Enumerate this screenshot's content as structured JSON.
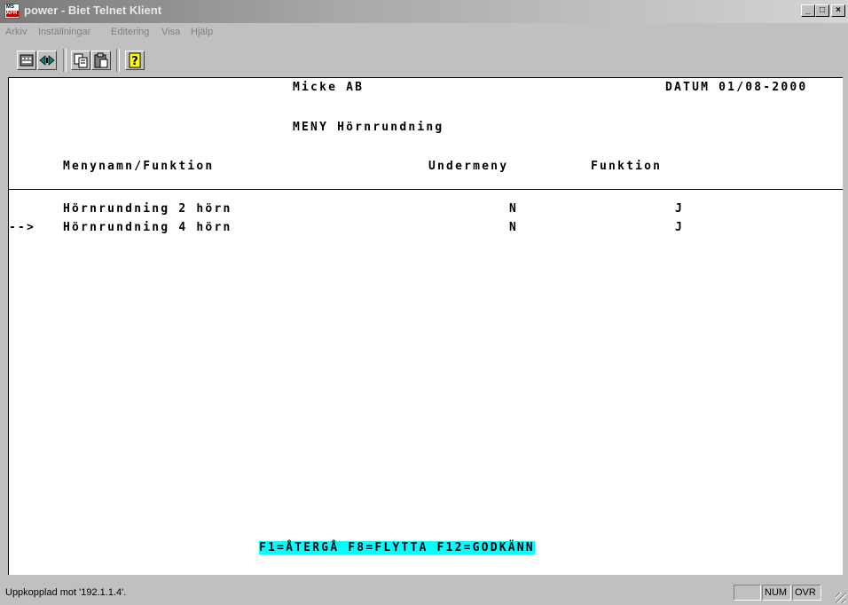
{
  "window": {
    "title": "power - Biet Telnet Klient",
    "icon_label_top": "MS",
    "icon_label_bottom": "AFR",
    "controls": {
      "minimize": "_",
      "maximize": "□",
      "close": "×"
    }
  },
  "menu": [
    {
      "label": "Arkiv",
      "name": "menu-arkiv"
    },
    {
      "label": "Inställningar",
      "name": "menu-installningar"
    },
    {
      "label": "Editering",
      "name": "menu-editering"
    },
    {
      "label": "Visa",
      "name": "menu-visa"
    },
    {
      "label": "Hjälp",
      "name": "menu-hjalp"
    }
  ],
  "toolbar": {
    "buttons": [
      "keyboard-icon",
      "connect-icon",
      "copy-icon",
      "paste-icon",
      "help-icon"
    ],
    "help_glyph": "?"
  },
  "terminal": {
    "company": "Micke AB",
    "date_label": "DATUM 01/08-2000",
    "menu_title": "MENY Hörnrundning",
    "columns": {
      "name": "Menynamn/Funktion",
      "submenu": "Undermeny",
      "function": "Funktion"
    },
    "rows": [
      {
        "pointer": "",
        "name": "Hörnrundning 2 hörn",
        "submenu": "N",
        "function": "J"
      },
      {
        "pointer": "-->",
        "name": "Hörnrundning 4 hörn",
        "submenu": "N",
        "function": "J"
      }
    ],
    "function_keys": "F1=ÅTERGÅ F8=FLYTTA F12=GODKÄNN"
  },
  "status": {
    "text": "Uppkopplad mot '192.1.1.4'.",
    "num": "NUM",
    "ovr": "OVR"
  },
  "colors": {
    "function_key_bg": "#00ffff",
    "terminal_bg": "#ffffff",
    "chrome": "#c0c0c0"
  }
}
